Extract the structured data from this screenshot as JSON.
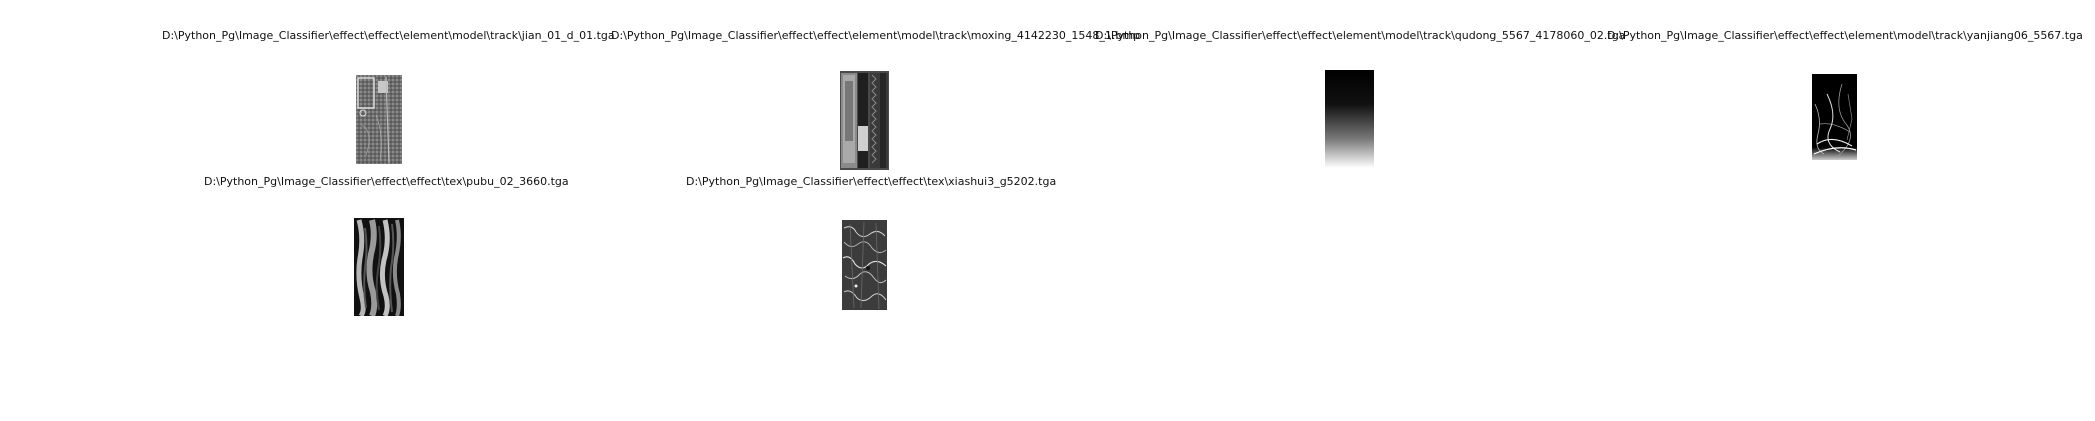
{
  "figure": {
    "panels": [
      {
        "title": "D:\\Python_Pg\\Image_Classifier\\effect\\effect\\element\\model\\track\\jian_01_d_01.tga",
        "image": "texture-jian"
      },
      {
        "title": "D:\\Python_Pg\\Image_Classifier\\effect\\effect\\element\\model\\track\\moxing_4142230_1548_1.bmp",
        "image": "texture-moxing"
      },
      {
        "title": "D:\\Python_Pg\\Image_Classifier\\effect\\effect\\element\\model\\track\\qudong_5567_4178060_02.tga",
        "image": "gradient-qudong"
      },
      {
        "title": "D:\\Python_Pg\\Image_Classifier\\effect\\effect\\element\\model\\track\\yanjiang06_5567.tga",
        "image": "texture-yanjiang"
      },
      {
        "title": "D:\\Python_Pg\\Image_Classifier\\effect\\effect\\tex\\pubu_02_3660.tga",
        "image": "texture-pubu"
      },
      {
        "title": "D:\\Python_Pg\\Image_Classifier\\effect\\effect\\tex\\xiashui3_g5202.tga",
        "image": "texture-xiashui"
      }
    ]
  }
}
